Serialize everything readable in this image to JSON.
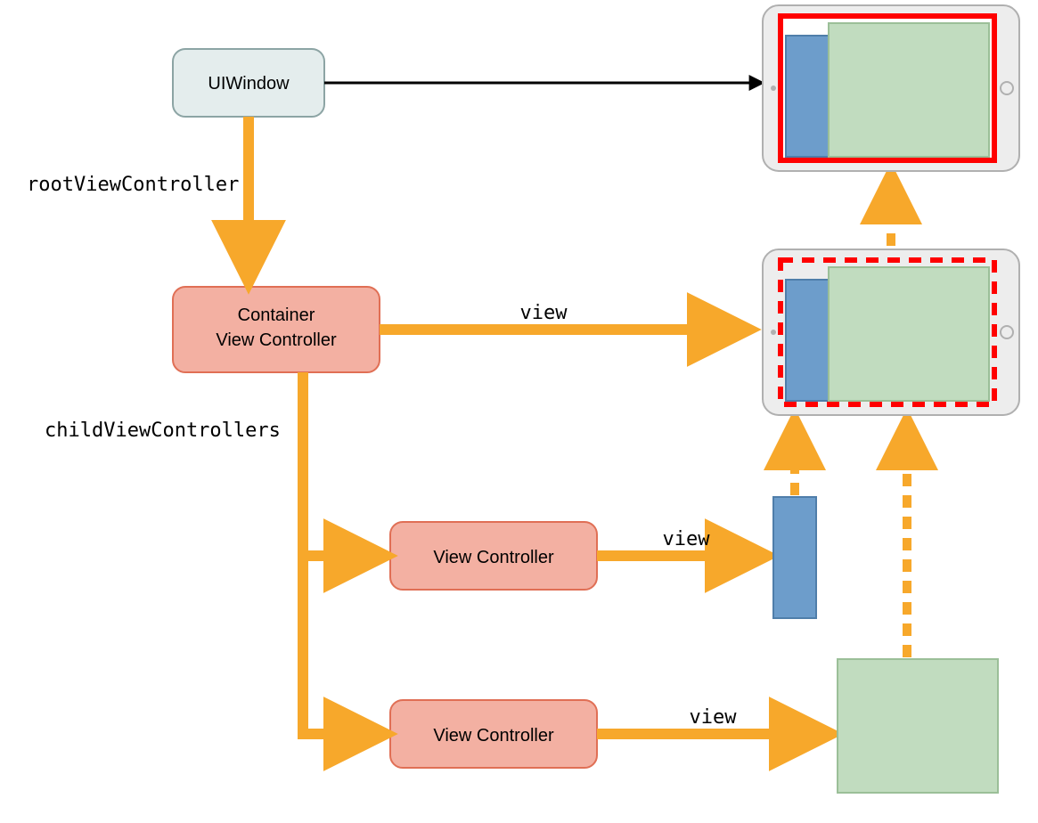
{
  "nodes": {
    "uiwindow": {
      "label": "UIWindow"
    },
    "container": {
      "line1": "Container",
      "line2": "View Controller"
    },
    "vc1": {
      "label": "View Controller"
    },
    "vc2": {
      "label": "View Controller"
    }
  },
  "labels": {
    "rootViewController": "rootViewController",
    "childViewControllers": "childViewControllers",
    "view1": "view",
    "view2": "view",
    "view3": "view"
  },
  "colors": {
    "uiwindow_fill": "#E4EDED",
    "uiwindow_stroke": "#8CA4A4",
    "container_fill": "#F3B0A2",
    "container_stroke": "#E06F55",
    "arrow_orange": "#F7A82B",
    "arrow_black": "#000000",
    "tablet_body": "#EDEDED",
    "tablet_stroke": "#B0B0B0",
    "red": "#FF0000",
    "blue_fill": "#6D9DCB",
    "blue_stroke": "#4F7EAA",
    "green_fill": "#C1DCBF",
    "green_stroke": "#9BBF98",
    "text": "#000000"
  }
}
